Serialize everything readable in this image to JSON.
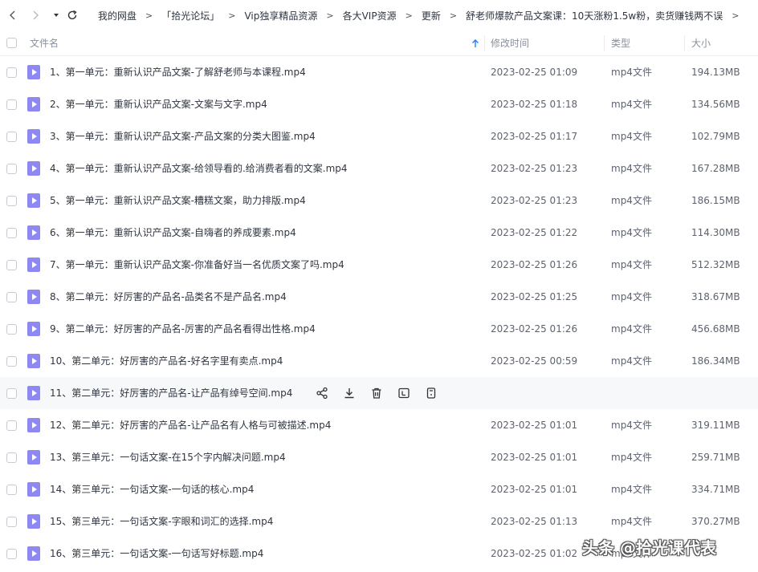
{
  "toolbar": {
    "back_icon": "chevron-left-icon",
    "forward_icon": "chevron-right-icon",
    "dropdown_icon": "caret-down-icon",
    "refresh_icon": "refresh-icon"
  },
  "breadcrumb": [
    "我的网盘",
    "「拾光论坛」",
    "Vip独享精品资源",
    "各大VIP资源",
    "更新",
    "舒老师爆款产品文案课：10天涨粉1.5w粉，卖货赚钱两不误"
  ],
  "breadcrumb_sep": ">",
  "columns": {
    "name": "文件名",
    "modified": "修改时间",
    "type": "类型",
    "size": "大小",
    "sort_icon": "sort-up-arrow-icon"
  },
  "colors": {
    "accent": "#1e80ff",
    "file_icon": "#8e88f5",
    "row_hover": "#f7f8fa"
  },
  "files": [
    {
      "name": "1、第一单元：重新认识产品文案-了解舒老师与本课程.mp4",
      "date": "2023-02-25 01:09",
      "type": "mp4文件",
      "size": "194.13MB"
    },
    {
      "name": "2、第一单元：重新认识产品文案-文案与文字.mp4",
      "date": "2023-02-25 01:18",
      "type": "mp4文件",
      "size": "134.56MB"
    },
    {
      "name": "3、第一单元：重新认识产品文案-产品文案的分类大图鉴.mp4",
      "date": "2023-02-25 01:17",
      "type": "mp4文件",
      "size": "102.79MB"
    },
    {
      "name": "4、第一单元：重新认识产品文案-给领导看的.给消费者看的文案.mp4",
      "date": "2023-02-25 01:23",
      "type": "mp4文件",
      "size": "167.28MB"
    },
    {
      "name": "5、第一单元：重新认识产品文案-糟糕文案，助力排版.mp4",
      "date": "2023-02-25 01:23",
      "type": "mp4文件",
      "size": "186.15MB"
    },
    {
      "name": "6、第一单元：重新认识产品文案-自嗨者的养成要素.mp4",
      "date": "2023-02-25 01:22",
      "type": "mp4文件",
      "size": "114.30MB"
    },
    {
      "name": "7、第一单元：重新认识产品文案-你准备好当一名优质文案了吗.mp4",
      "date": "2023-02-25 01:26",
      "type": "mp4文件",
      "size": "512.32MB"
    },
    {
      "name": "8、第二单元：好厉害的产品名-品类名不是产品名.mp4",
      "date": "2023-02-25 01:25",
      "type": "mp4文件",
      "size": "318.67MB"
    },
    {
      "name": "9、第二单元：好厉害的产品名-厉害的产品名看得出性格.mp4",
      "date": "2023-02-25 01:26",
      "type": "mp4文件",
      "size": "456.68MB"
    },
    {
      "name": "10、第二单元：好厉害的产品名-好名字里有卖点.mp4",
      "date": "2023-02-25 00:59",
      "type": "mp4文件",
      "size": "186.34MB"
    },
    {
      "name": "11、第二单元：好厉害的产品名-让产品有绰号空间.mp4",
      "date": "",
      "type": "",
      "size": "",
      "hover": true
    },
    {
      "name": "12、第二单元：好厉害的产品名-让产品名有人格与可被描述.mp4",
      "date": "2023-02-25 01:01",
      "type": "mp4文件",
      "size": "319.11MB"
    },
    {
      "name": "13、第三单元：一句话文案-在15个字内解决问题.mp4",
      "date": "2023-02-25 01:01",
      "type": "mp4文件",
      "size": "259.71MB"
    },
    {
      "name": "14、第三单元：一句话文案-一句话的核心.mp4",
      "date": "2023-02-25 01:01",
      "type": "mp4文件",
      "size": "334.71MB"
    },
    {
      "name": "15、第三单元：一句话文案-字眼和词汇的选择.mp4",
      "date": "2023-02-25 01:13",
      "type": "mp4文件",
      "size": "370.27MB"
    },
    {
      "name": "16、第三单元：一句话文案-一句话写好标题.mp4",
      "date": "2023-02-25 01:02",
      "type": "mp4文件",
      "size": ""
    }
  ],
  "row_actions": [
    "share-icon",
    "download-icon",
    "delete-icon",
    "rename-icon",
    "more-icon"
  ],
  "watermark": "头条 @拾光课代表"
}
